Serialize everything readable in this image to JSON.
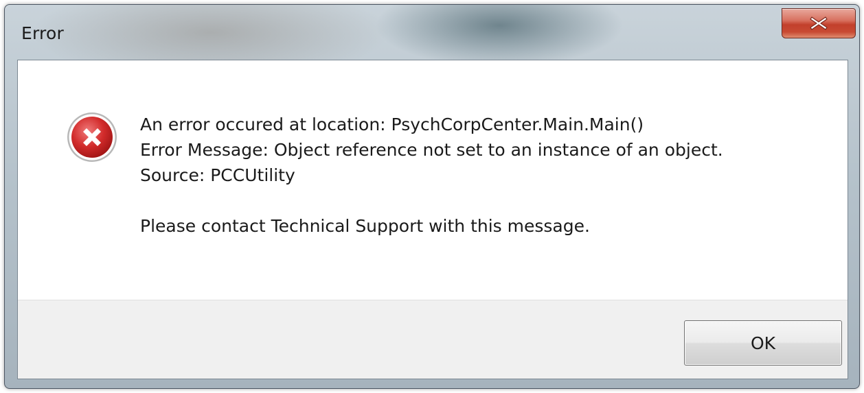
{
  "window": {
    "title": "Error",
    "close_icon": "close-x-icon"
  },
  "dialog": {
    "icon": "error-icon",
    "lines": [
      "An error occured at location: PsychCorpCenter.Main.Main()",
      "Error Message: Object reference not set to an instance of an object.",
      "Source: PCCUtility"
    ],
    "support_message": "Please contact Technical Support with this message."
  },
  "buttons": {
    "ok_label": "OK"
  },
  "colors": {
    "close_button": "#c84a33",
    "error_icon": "#c0272d",
    "footer_background": "#f0f0f0"
  }
}
